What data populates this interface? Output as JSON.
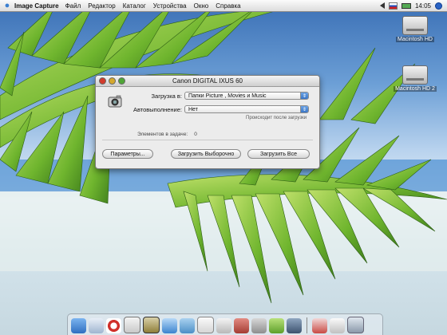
{
  "menubar": {
    "app_name": "Image Capture",
    "items": [
      "Файл",
      "Редактор",
      "Каталог",
      "Устройства",
      "Окно",
      "Справка"
    ],
    "clock": "14:05"
  },
  "desktop": {
    "disk1_label": "Macintosh HD",
    "disk2_label": "Macintosh HD 2"
  },
  "window": {
    "title": "Canon DIGITAL IXUS 60",
    "download_to_label": "Загрузка в:",
    "download_to_value": "Папки Picture , Movies и Music",
    "autotask_label": "Автовыполнение:",
    "autotask_value": "Нет",
    "hint": "Происходит после загрузки",
    "items_label": "Элементов в задаче:",
    "items_value": "0",
    "options_button": "Параметры...",
    "download_some_button": "Загрузить Выборочно",
    "download_all_button": "Загрузить Все"
  },
  "colors": {
    "accent": "#2e6bbf",
    "close": "#d33b2b",
    "minimize": "#d5a82d",
    "zoom": "#4fa636"
  },
  "dock": {
    "icons": [
      "finder-icon",
      "mail-icon",
      "ie-icon",
      "ical-icon",
      "image-capture-icon",
      "itunes-icon",
      "iphoto-icon",
      "textedit-icon",
      "preview-icon",
      "app-icon",
      "utility-icon",
      "pencil-icon",
      "tool-icon",
      "app2-icon",
      "cup-icon",
      "trash-icon"
    ]
  }
}
